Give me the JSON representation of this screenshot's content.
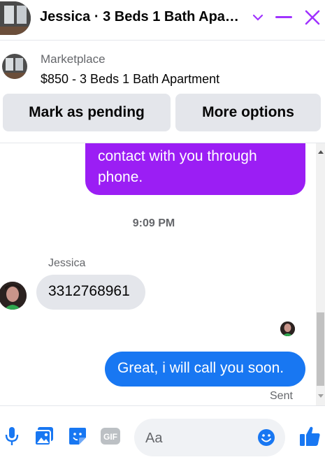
{
  "header": {
    "title": "Jessica · 3 Beds 1 Bath Apa…",
    "accent": "#a033ff"
  },
  "listing": {
    "category": "Marketplace",
    "name": "$850 - 3 Beds 1 Bath Apartment",
    "mark_pending_label": "Mark as pending",
    "more_options_label": "More options"
  },
  "messages": {
    "outgoing_partial": "contact with you through phone.",
    "timestamp": "9:09 PM",
    "sender_name": "Jessica",
    "incoming": "3312768961",
    "outgoing": "Great, i will call you soon.",
    "status": "Sent",
    "outgoing_color": "#1877f2",
    "purple_color": "#9b1ef4"
  },
  "composer": {
    "placeholder": "Aa",
    "icons": [
      "microphone-icon",
      "photo-icon",
      "sticker-icon",
      "gif-icon",
      "emoji-icon",
      "like-icon"
    ]
  }
}
